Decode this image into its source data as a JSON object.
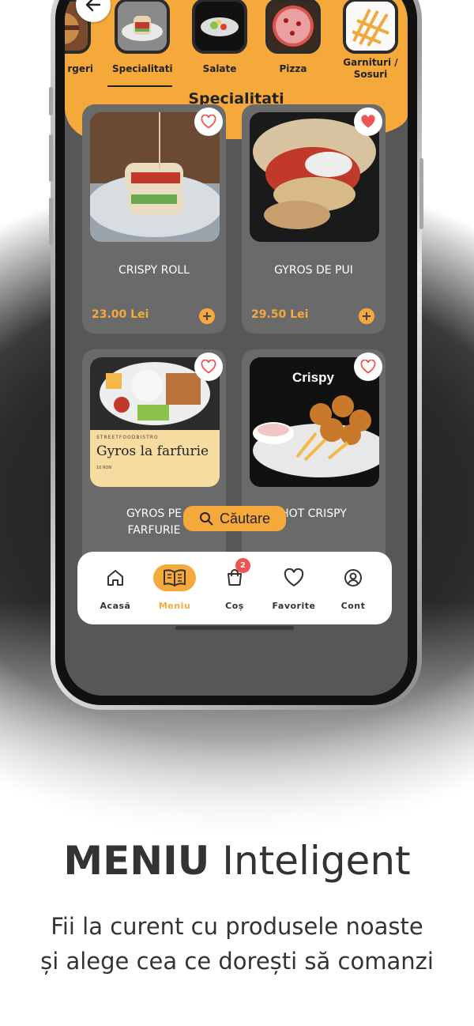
{
  "categories": [
    {
      "label": "rgeri"
    },
    {
      "label": "Specialitati",
      "active": true
    },
    {
      "label": "Salate"
    },
    {
      "label": "Pizza"
    },
    {
      "label": "Garnituri /\nSosuri"
    }
  ],
  "section_title": "Specialitati",
  "products": [
    {
      "name": "CRISPY ROLL",
      "price": "23.00 Lei",
      "favorite": false
    },
    {
      "name": "GYROS DE PUI",
      "price": "29.50 Lei",
      "favorite": true
    },
    {
      "name": "GYROS PE\nFARFURIE",
      "price": "",
      "favorite": false,
      "image_text": {
        "brand": "STREETFOODBISTRO",
        "title": "Gyros la farfurie",
        "weight": "10 RON"
      }
    },
    {
      "name": "HOT CRISPY",
      "price": "",
      "favorite": false,
      "image_text": {
        "title": "Crispy"
      }
    }
  ],
  "search": {
    "label": "Căutare"
  },
  "nav": [
    {
      "label": "Acasă",
      "icon": "home-icon"
    },
    {
      "label": "Meniu",
      "icon": "menu-book-icon",
      "active": true
    },
    {
      "label": "Coș",
      "icon": "cart-icon",
      "badge": "2"
    },
    {
      "label": "Favorite",
      "icon": "heart-icon"
    },
    {
      "label": "Cont",
      "icon": "user-icon"
    }
  ],
  "marketing": {
    "headline_bold": "MENIU",
    "headline_rest": " Inteligent",
    "sub_line1": "Fii la curent cu produsele noaste",
    "sub_line2": "și alege cea ce dorești să comanzi"
  },
  "colors": {
    "accent": "#f6a93b",
    "card": "#6a6a6a",
    "screen": "#575757",
    "badge": "#ef5454",
    "heart": "#ef5454"
  }
}
